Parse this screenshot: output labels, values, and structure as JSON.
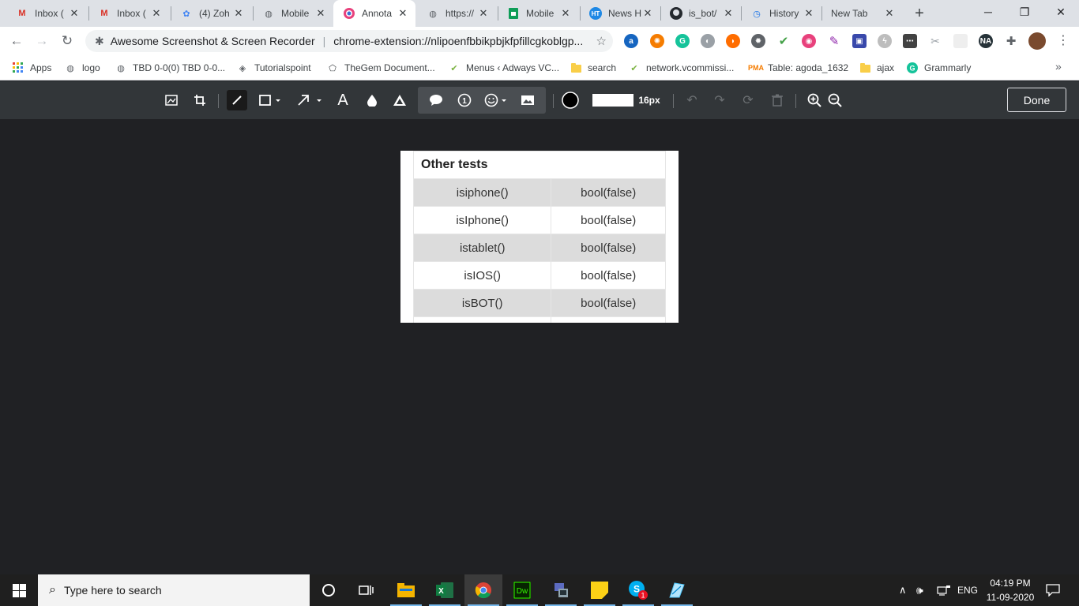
{
  "tabs": [
    {
      "title": "Inbox (",
      "icon": "gmail-icon",
      "color": "#d93025"
    },
    {
      "title": "Inbox (",
      "icon": "gmail-icon",
      "color": "#d93025"
    },
    {
      "title": "(4) Zoh",
      "icon": "zoho-icon",
      "color": "#4285f4"
    },
    {
      "title": "Mobile",
      "icon": "globe-icon",
      "color": "#5f6368"
    },
    {
      "title": "Annota",
      "icon": "awesome-screenshot-icon",
      "color": "#e8417c"
    },
    {
      "title": "https://",
      "icon": "globe-icon",
      "color": "#5f6368"
    },
    {
      "title": "Mobile",
      "icon": "sheets-icon",
      "color": "#0f9d58"
    },
    {
      "title": "News H",
      "icon": "ht-icon",
      "color": "#1e88e5"
    },
    {
      "title": "is_bot/",
      "icon": "github-icon",
      "color": "#24292e"
    },
    {
      "title": "History",
      "icon": "history-icon",
      "color": "#1a73e8"
    },
    {
      "title": "New Tab",
      "icon": "",
      "color": "#5f6368"
    }
  ],
  "address": {
    "site_name": "Awesome Screenshot & Screen Recorder",
    "url": "chrome-extension://nlipoenfbbikpbjkfpfillcgkoblgp..."
  },
  "bookmarks": [
    {
      "label": "Apps",
      "icon": "apps-grid-icon"
    },
    {
      "label": "logo",
      "icon": "globe-icon"
    },
    {
      "label": "TBD 0-0(0) TBD 0-0...",
      "icon": "globe-icon"
    },
    {
      "label": "Tutorialspoint",
      "icon": "tutorialspoint-icon"
    },
    {
      "label": "TheGem Document...",
      "icon": "gem-icon"
    },
    {
      "label": "Menus ‹ Adways VC...",
      "icon": "wp-check-icon"
    },
    {
      "label": "search",
      "icon": "folder-icon"
    },
    {
      "label": "network.vcommissi...",
      "icon": "wp-check-icon"
    },
    {
      "label": "Table: agoda_1632",
      "icon": "pma-icon"
    },
    {
      "label": "ajax",
      "icon": "folder-icon"
    },
    {
      "label": "Grammarly",
      "icon": "grammarly-icon"
    }
  ],
  "annotation_toolbar": {
    "size_label": "16px",
    "done_label": "Done",
    "active_color": "#000000"
  },
  "screenshot_table": {
    "header": "Other tests",
    "rows": [
      {
        "fn": "isiphone()",
        "val": "bool(false)"
      },
      {
        "fn": "isIphone()",
        "val": "bool(false)"
      },
      {
        "fn": "istablet()",
        "val": "bool(false)"
      },
      {
        "fn": "isIOS()",
        "val": "bool(false)"
      },
      {
        "fn": "isBOT()",
        "val": "bool(false)"
      }
    ]
  },
  "taskbar": {
    "search_placeholder": "Type here to search",
    "language": "ENG",
    "time": "04:19 PM",
    "date": "11-09-2020",
    "skype_badge": "1"
  }
}
